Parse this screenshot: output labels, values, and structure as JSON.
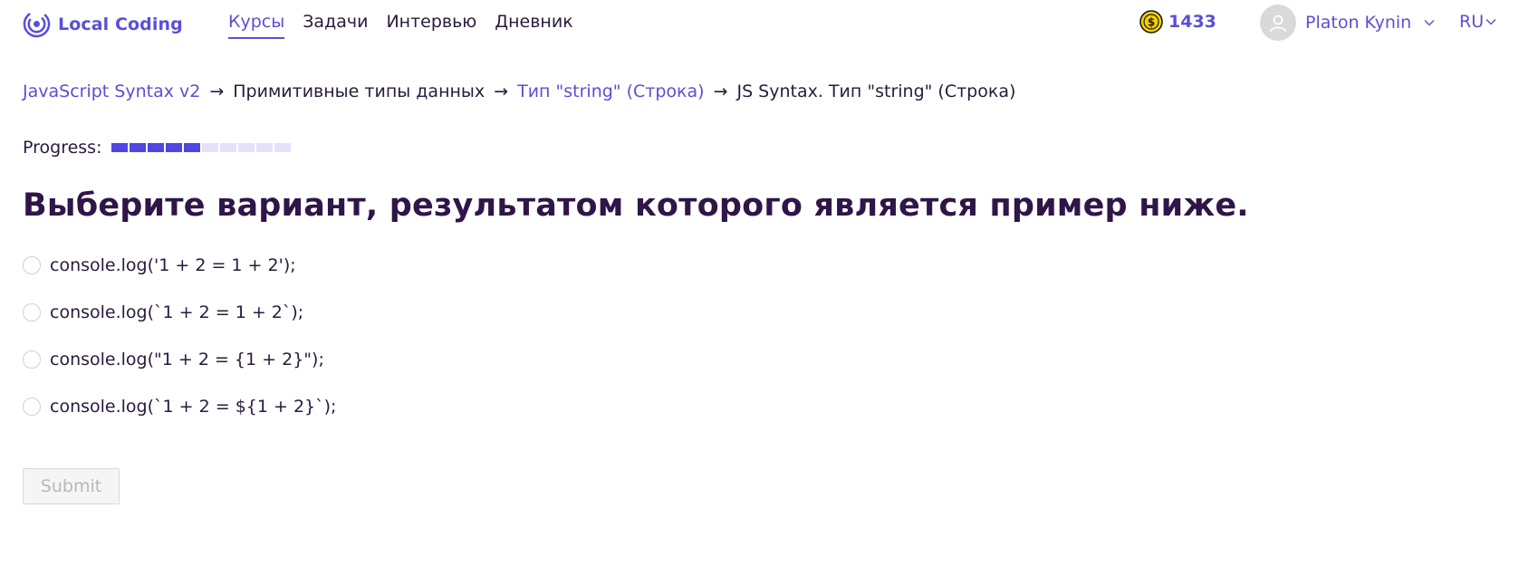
{
  "header": {
    "logo_text": "Local Coding",
    "nav": [
      {
        "label": "Курсы",
        "active": true
      },
      {
        "label": "Задачи",
        "active": false
      },
      {
        "label": "Интервью",
        "active": false
      },
      {
        "label": "Дневник",
        "active": false
      }
    ],
    "coins": "1433",
    "user_name": "Platon Kynin",
    "language": "RU"
  },
  "breadcrumb": {
    "course": "JavaScript Syntax v2",
    "section": "Примитивные типы данных",
    "topic": "Тип \"string\" (Строка)",
    "current": "JS Syntax. Тип \"string\" (Строка)",
    "separator": "→"
  },
  "progress": {
    "label": "Progress:",
    "completed": 5,
    "total": 10
  },
  "question": "Выберите вариант, результатом которого является пример ниже.",
  "options": [
    "console.log('1 + 2 = 1 + 2');",
    "console.log(`1 + 2 = 1 + 2`);",
    "console.log(\"1 + 2 = {1 + 2}\");",
    "console.log(`1 + 2 = ${1 + 2}`);"
  ],
  "submit_label": "Submit",
  "colors": {
    "accent": "#5a4fd6",
    "progress_filled": "#4f46e5",
    "progress_empty": "#e4e2fb",
    "heading": "#2f1548",
    "coin": "#f5d000"
  }
}
